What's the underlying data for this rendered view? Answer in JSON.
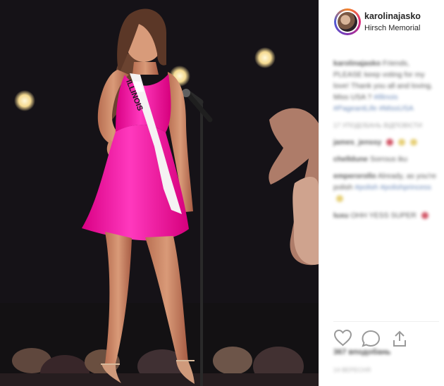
{
  "post": {
    "username": "karolinajasko",
    "location": "Hirsch Memorial",
    "sash_text": "ILLINOIS",
    "caption": {
      "username": "karolinajasko",
      "text": "Friends, PLEASE keep voting for my love! Thank you all and loving. Miss USA ?",
      "tags": "#illinois #PageantLife #MissUSA"
    },
    "caption_meta": "17 уподобань Відповісти",
    "comments": [
      {
        "username": "james_jenssy",
        "text": "",
        "tail": "heart"
      },
      {
        "username": "chelldune",
        "text": "Sorrous iku",
        "tail": ""
      },
      {
        "username": "emperorollo",
        "text": "Already, as you're polish",
        "tags": "#polish #polishprincess",
        "tail": "emoji"
      },
      {
        "username": "luxu",
        "text": "OHH YESS SUPER",
        "tail": "heart"
      }
    ],
    "likes": "367 вподобань",
    "date": "14 ВЕРЕСНЯ"
  },
  "icons": {
    "like": "heart-icon",
    "comment": "comment-icon",
    "share": "share-icon",
    "comment_heart": "heart-icon",
    "comment_emoji": "smile-icon"
  },
  "colors": {
    "dress": "#ff1aa8",
    "background": "#120f12",
    "sidebar": "#ffffff",
    "tag": "#4d71a9",
    "ring_gradient": [
      "#f58529",
      "#dd2a7b",
      "#8134af",
      "#515bd4"
    ]
  }
}
